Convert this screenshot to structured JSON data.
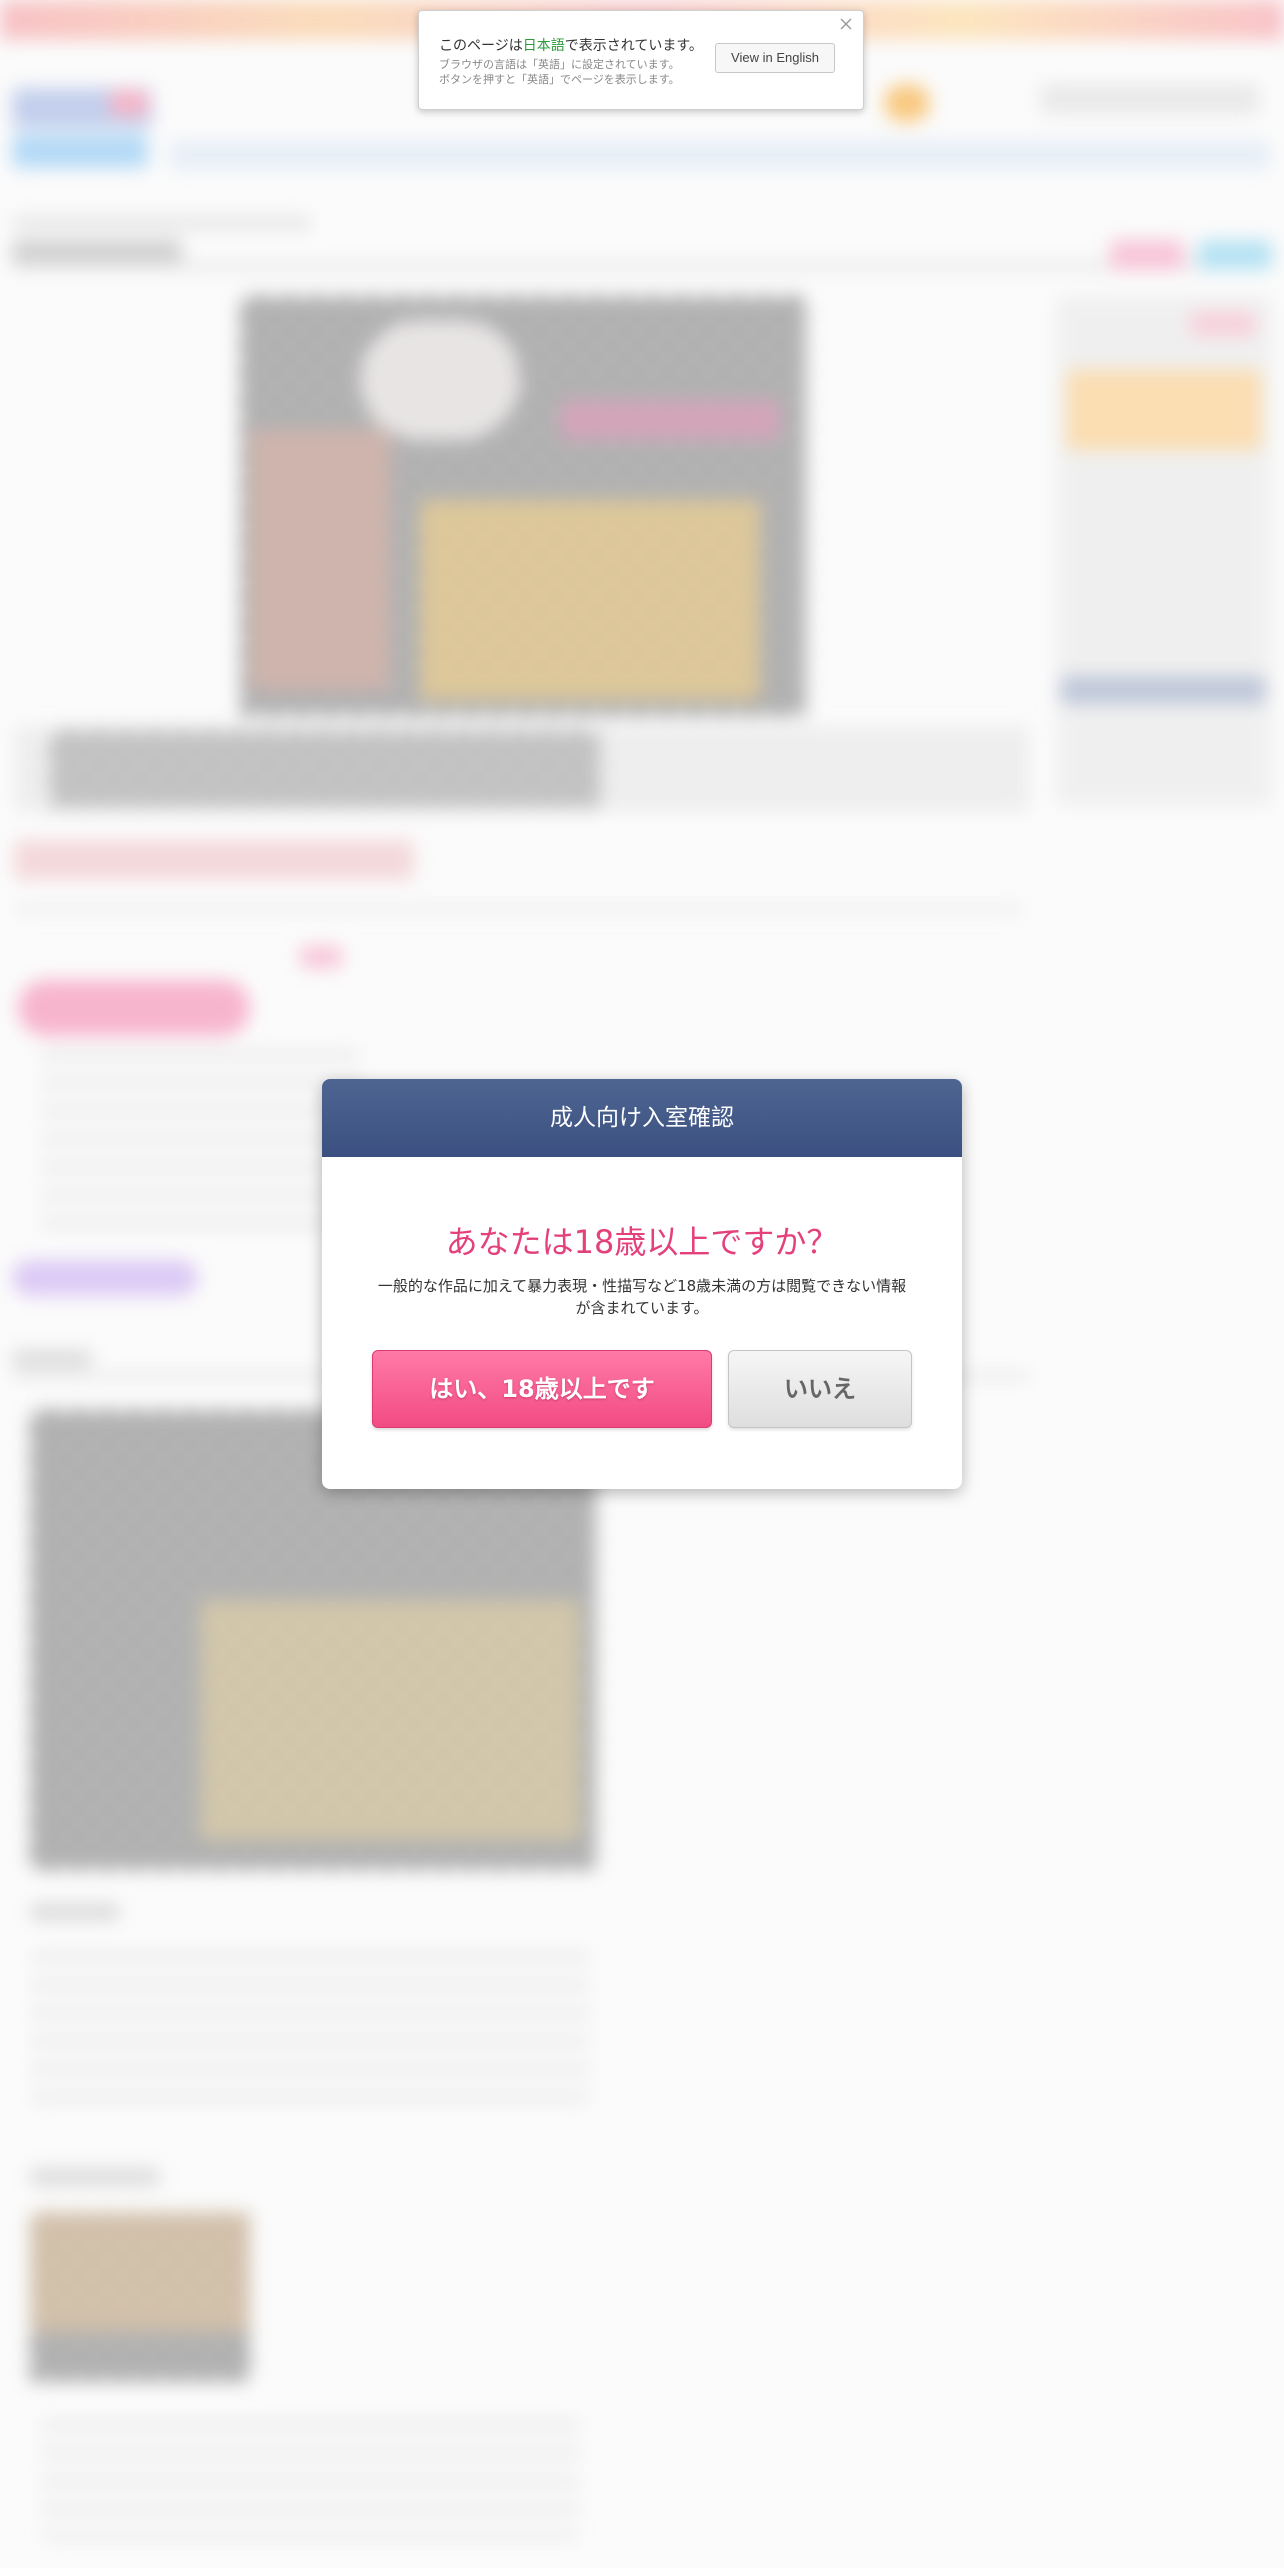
{
  "language_notice": {
    "prefix": "このページは",
    "language": "日本語",
    "suffix": "で表示されています。",
    "sub_line_1": "ブラウザの言語は「英語」に設定されています。",
    "sub_line_2": "ボタンを押すと「英語」でページを表示します。",
    "english_button_label": "View in English",
    "language_color": "#2a9a3a"
  },
  "age_gate": {
    "title": "成人向け入室確認",
    "question": "あなたは18歳以上ですか？",
    "description": "一般的な作品に加えて暴力表現・性描写など18歳未満の方は閲覧できない情報が含まれています。",
    "yes_label": "はい、18歳以上です",
    "no_label": "いいえ",
    "header_color": "#45598a",
    "question_color": "#e4407c",
    "yes_color": "#f24b84"
  }
}
